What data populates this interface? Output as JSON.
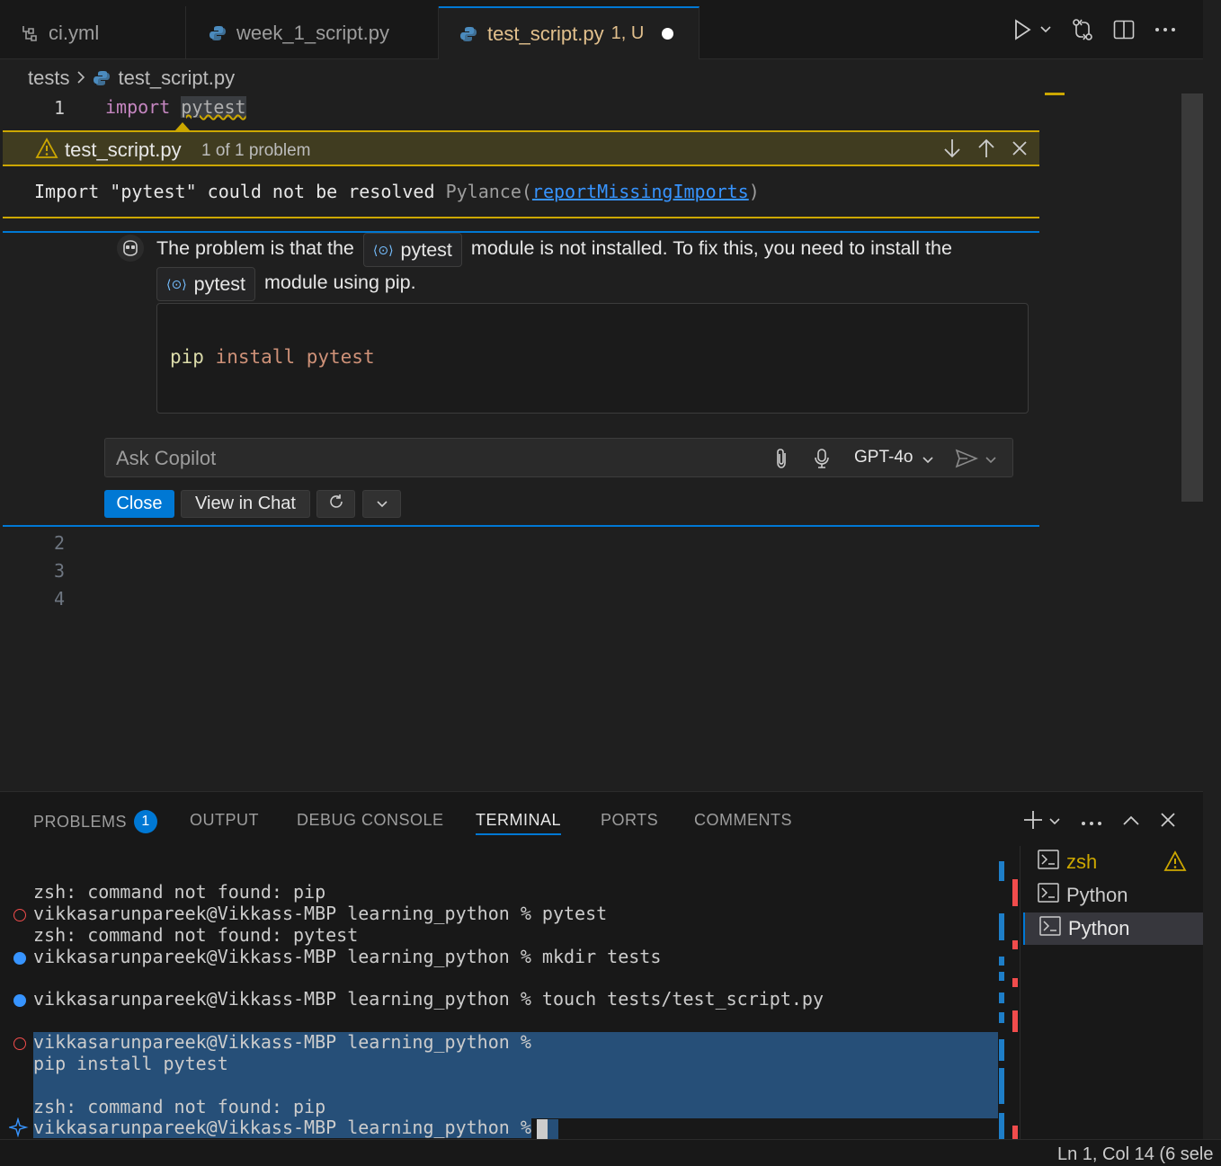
{
  "tabs": [
    {
      "label": "ci.yml",
      "icon": "yaml-file-icon"
    },
    {
      "label": "week_1_script.py",
      "icon": "python-file-icon"
    },
    {
      "label": "test_script.py",
      "status": "1, U",
      "icon": "python-file-icon",
      "active": true,
      "modified": true
    }
  ],
  "breadcrumb": {
    "folder": "tests",
    "file": "test_script.py"
  },
  "editor": {
    "lines": [
      {
        "no": "1",
        "keyword": "import",
        "module": "pytest"
      },
      {
        "no": "2"
      },
      {
        "no": "3"
      },
      {
        "no": "4"
      }
    ]
  },
  "peek": {
    "file": "test_script.py",
    "count": "1 of 1 problem",
    "message": "Import \"pytest\" could not be resolved",
    "source": "Pylance(",
    "rule": "reportMissingImports",
    "source_close": ")"
  },
  "copilot": {
    "text_1": "The problem is that the",
    "chip": "pytest",
    "text_2": "module is not installed. To fix this, you need to install the",
    "text_3": "module using pip.",
    "code_cmd": "pip",
    "code_args": "install pytest",
    "ask_placeholder": "Ask Copilot",
    "model": "GPT-4o",
    "close_label": "Close",
    "view_chat_label": "View in Chat"
  },
  "panel": {
    "tabs": [
      "PROBLEMS",
      "OUTPUT",
      "DEBUG CONSOLE",
      "TERMINAL",
      "PORTS",
      "COMMENTS"
    ],
    "problems_count": "1",
    "active_tab": "TERMINAL"
  },
  "terminal": {
    "lines": [
      "zsh: command not found: pip",
      "vikkasarunpareek@Vikkass-MBP learning_python % pytest",
      "zsh: command not found: pytest",
      "vikkasarunpareek@Vikkass-MBP learning_python % mkdir tests",
      "vikkasarunpareek@Vikkass-MBP learning_python % touch tests/test_script.py",
      "vikkasarunpareek@Vikkass-MBP learning_python %",
      "pip install pytest",
      "zsh: command not found: pip",
      "vikkasarunpareek@Vikkass-MBP learning_python %"
    ]
  },
  "terminal_list": [
    {
      "label": "zsh",
      "warning": true
    },
    {
      "label": "Python"
    },
    {
      "label": "Python",
      "selected": true
    }
  ],
  "statusbar": {
    "position": "Ln 1, Col 14 (6 sele"
  },
  "colors": {
    "accent": "#0078d4",
    "warning": "#cca700",
    "error": "#f14c4c",
    "modified_tab": "#e2c08d"
  }
}
